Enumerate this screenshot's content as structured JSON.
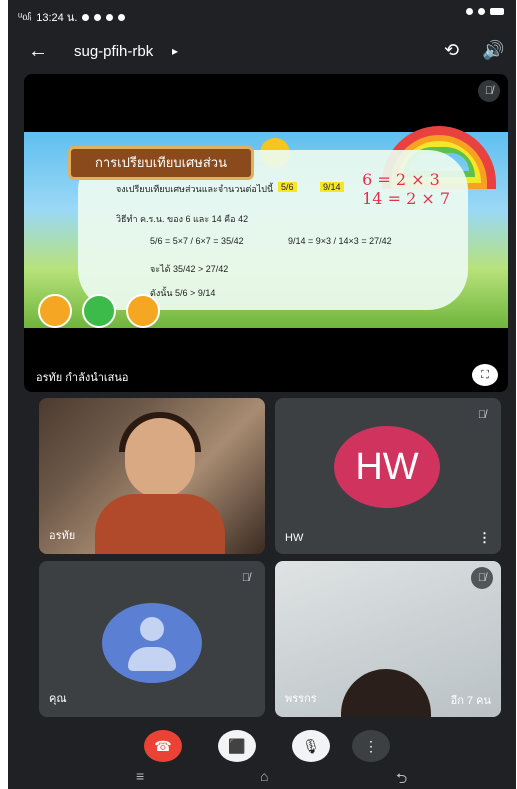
{
  "status_bar": {
    "carrier": "ᵘ᧞ᵢ",
    "time": "13:24 น.",
    "right_icons": [
      "vibrate-icon",
      "wifi-icon",
      "battery-icon"
    ]
  },
  "app_bar": {
    "back_icon": "←",
    "meeting_code": "sug-pfih-rbk",
    "dropdown_icon": "▸",
    "camera_switch_icon": "⟲",
    "speaker_icon": "🔊"
  },
  "presentation": {
    "slide_title": "การเปรียบเทียบเศษส่วน",
    "slide_question": "จงเปรียบเทียบเศษส่วนและจำนวนต่อไปนี้",
    "fraction_a": "5/6",
    "fraction_b": "9/14",
    "line_method": "วิธีทำ  ค.ร.น. ของ 6 และ 14 คือ 42",
    "line_a": "5/6 = 5×7 / 6×7 = 35/42",
    "line_b": "9/14 = 9×3 / 14×3 = 27/42",
    "line_result": "จะได้  35/42 > 27/42",
    "line_conclusion": "ดังนั้น  5/6 > 9/14",
    "handwriting_1": "6 = 2 × 3",
    "handwriting_2": "14 = 2 × 7",
    "presenter_label": "อรทัย กำลังนำเสนอ",
    "fullscreen_icon": "⛶"
  },
  "tiles": [
    {
      "name": "อรทัย",
      "type": "video"
    },
    {
      "name": "HW",
      "initials": "HW",
      "type": "avatar",
      "more": "⋮"
    },
    {
      "name": "คุณ",
      "type": "avatar"
    },
    {
      "name": "พรรกร",
      "type": "video",
      "extra": "อีก 7 คน"
    }
  ],
  "mic_off_icon": "🎙̸",
  "controls": {
    "hangup_icon": "☎",
    "camera_off_icon": "⬛",
    "mic_off_icon": "🎙",
    "more_icon": "⋮"
  },
  "nav": {
    "recent": "≡",
    "home": "⌂",
    "back": "⮌"
  },
  "colors": {
    "hangup": "#ea4335",
    "hw_avatar": "#d1335f",
    "self_avatar": "#5b7fd3"
  }
}
